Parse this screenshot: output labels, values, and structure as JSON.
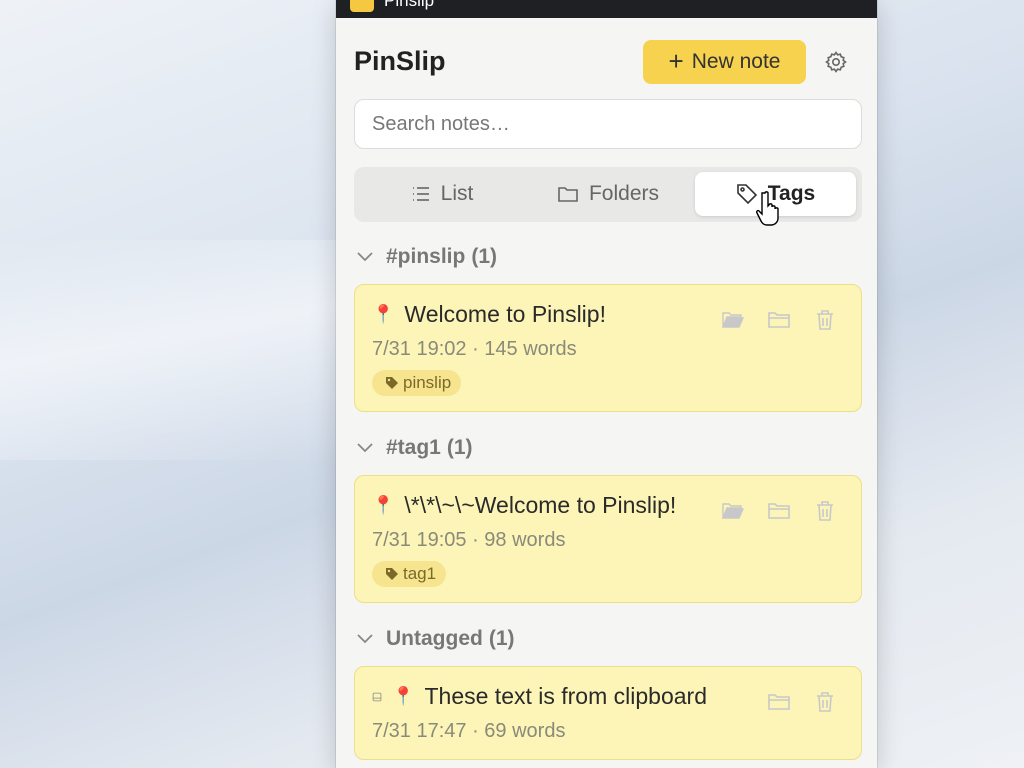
{
  "window": {
    "title": "Pinslip"
  },
  "header": {
    "app_name": "PinSlip",
    "new_note_label": "New note"
  },
  "search": {
    "placeholder": "Search notes…"
  },
  "view_tabs": [
    {
      "label": "List",
      "icon": "list-icon",
      "active": false
    },
    {
      "label": "Folders",
      "icon": "folder-icon",
      "active": false
    },
    {
      "label": "Tags",
      "icon": "tag-icon",
      "active": true
    }
  ],
  "groups": [
    {
      "name": "#pinslip",
      "count": "(1)",
      "notes": [
        {
          "title": "Welcome to Pinslip!",
          "meta": "7/31 19:02 · 145 words",
          "tag": "pinslip",
          "pinned": true
        }
      ]
    },
    {
      "name": "#tag1",
      "count": "(1)",
      "notes": [
        {
          "title": "\\*\\*\\~\\~Welcome to Pinslip!",
          "meta": "7/31 19:05 · 98 words",
          "tag": "tag1",
          "pinned": true
        }
      ]
    },
    {
      "name": "Untagged",
      "count": "(1)",
      "notes": [
        {
          "title": "These text is from clipboard",
          "meta": "7/31 17:47 · 69 words",
          "pinned": true,
          "clipboard": true
        }
      ]
    }
  ],
  "colors": {
    "accent": "#f7d24e",
    "card_bg": "#fdf5b8",
    "card_border": "#ecdf85",
    "tag_bg": "#f6e48e"
  }
}
